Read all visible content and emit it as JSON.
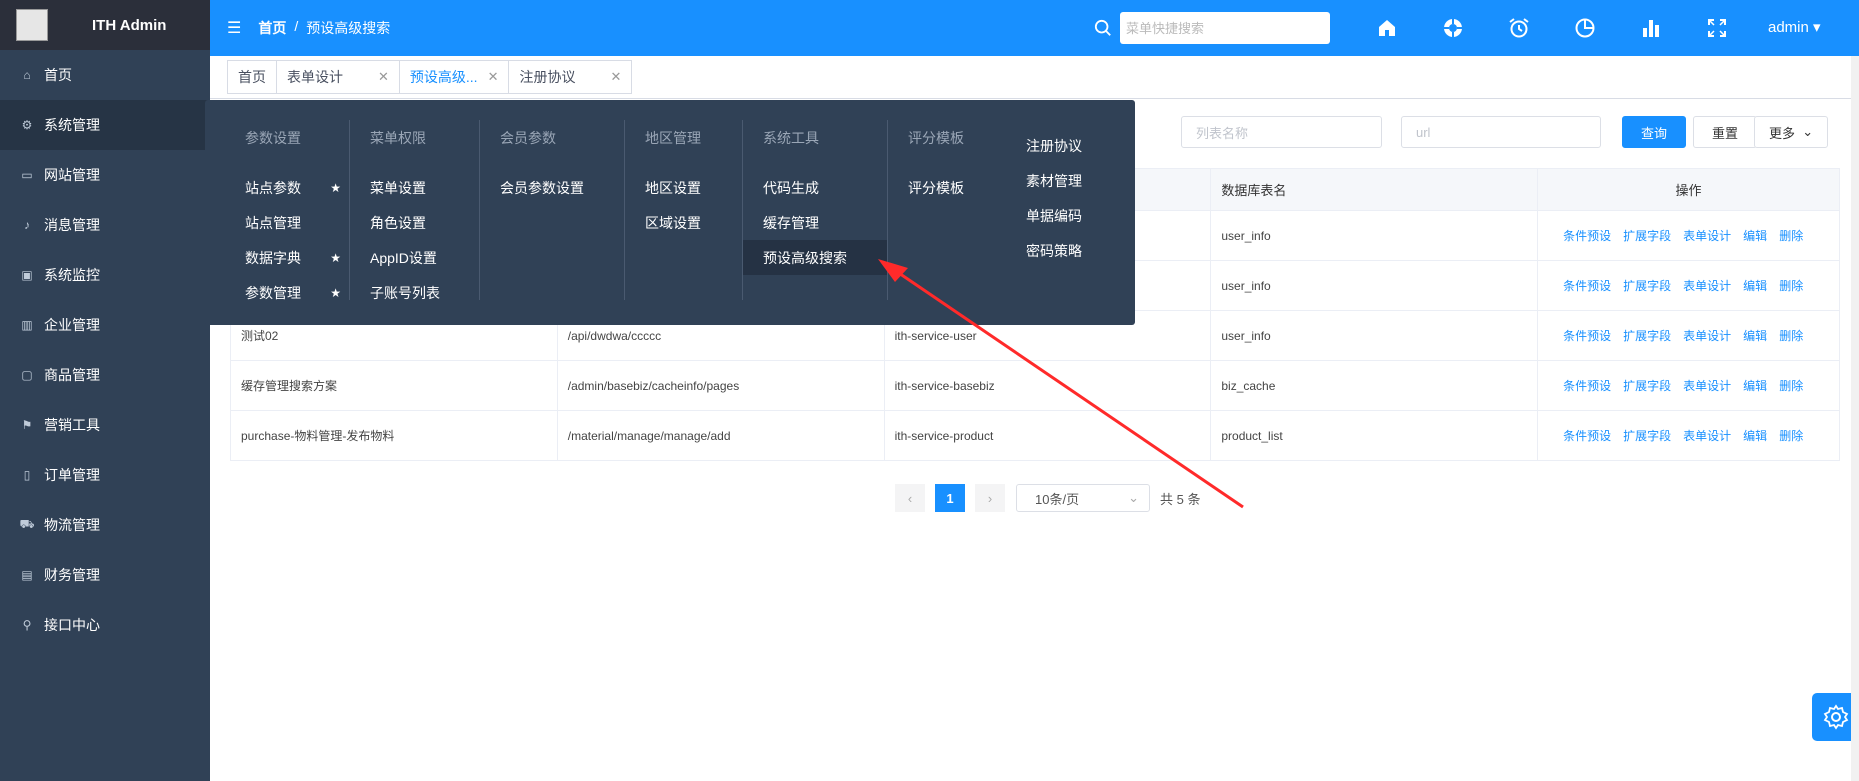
{
  "app": {
    "title": "ITH Admin"
  },
  "sidebar": {
    "items": [
      {
        "label": "首页",
        "icon": "home-icon"
      },
      {
        "label": "系统管理",
        "icon": "gear-icon"
      },
      {
        "label": "网站管理",
        "icon": "card-icon"
      },
      {
        "label": "消息管理",
        "icon": "bell-icon"
      },
      {
        "label": "系统监控",
        "icon": "monitor-icon"
      },
      {
        "label": "企业管理",
        "icon": "building-icon"
      },
      {
        "label": "商品管理",
        "icon": "bag-icon"
      },
      {
        "label": "营销工具",
        "icon": "flag-icon"
      },
      {
        "label": "订单管理",
        "icon": "phone-icon"
      },
      {
        "label": "物流管理",
        "icon": "truck-icon"
      },
      {
        "label": "财务管理",
        "icon": "wallet-icon"
      },
      {
        "label": "接口中心",
        "icon": "link-icon"
      }
    ]
  },
  "header": {
    "breadcrumb": [
      "首页",
      "/",
      "预设高级搜索"
    ],
    "search_placeholder": "菜单快捷搜索",
    "user": "admin"
  },
  "tabs": [
    {
      "label": "首页"
    },
    {
      "label": "表单设计"
    },
    {
      "label": "预设高级..."
    },
    {
      "label": "注册协议"
    }
  ],
  "filter": {
    "name_placeholder": "列表名称",
    "url_placeholder": "url",
    "query": "查询",
    "reset": "重置",
    "more": "更多"
  },
  "table": {
    "headers": [
      "数据库表名",
      "操作"
    ],
    "rows": [
      {
        "name": "",
        "url": "",
        "service": "",
        "table": "user_info"
      },
      {
        "name": "",
        "url": "",
        "service": "",
        "table": "user_info"
      },
      {
        "name": "测试02",
        "url": "/api/dwdwa/ccccc",
        "service": "ith-service-user",
        "table": "user_info"
      },
      {
        "name": "缓存管理搜索方案",
        "url": "/admin/basebiz/cacheinfo/pages",
        "service": "ith-service-basebiz",
        "table": "biz_cache"
      },
      {
        "name": "purchase-物料管理-发布物料",
        "url": "/material/manage/manage/add",
        "service": "ith-service-product",
        "table": "product_list"
      }
    ],
    "ops": [
      "条件预设",
      "扩展字段",
      "表单设计",
      "编辑",
      "删除"
    ]
  },
  "pager": {
    "current": "1",
    "size": "10条/页",
    "total": "共 5 条"
  },
  "mega_menu": {
    "columns": [
      {
        "title": "参数设置",
        "items": [
          {
            "label": "站点参数",
            "star": true
          },
          {
            "label": "站点管理",
            "star": false
          },
          {
            "label": "数据字典",
            "star": true
          },
          {
            "label": "参数管理",
            "star": true
          }
        ]
      },
      {
        "title": "菜单权限",
        "items": [
          {
            "label": "菜单设置"
          },
          {
            "label": "角色设置"
          },
          {
            "label": "AppID设置"
          },
          {
            "label": "子账号列表"
          }
        ]
      },
      {
        "title": "会员参数",
        "items": [
          {
            "label": "会员参数设置"
          }
        ]
      },
      {
        "title": "地区管理",
        "items": [
          {
            "label": "地区设置"
          },
          {
            "label": "区域设置"
          }
        ]
      },
      {
        "title": "系统工具",
        "items": [
          {
            "label": "代码生成"
          },
          {
            "label": "缓存管理"
          },
          {
            "label": "预设高级搜索"
          }
        ]
      },
      {
        "title": "评分模板",
        "items": [
          {
            "label": "评分模板"
          }
        ]
      },
      {
        "title": "",
        "items": [
          {
            "label": "注册协议"
          },
          {
            "label": "素材管理"
          },
          {
            "label": "单据编码"
          },
          {
            "label": "密码策略"
          }
        ]
      }
    ]
  },
  "colors": {
    "primary": "#1890ff",
    "sidebar": "#304156",
    "arrow": "#ff2a2a"
  }
}
